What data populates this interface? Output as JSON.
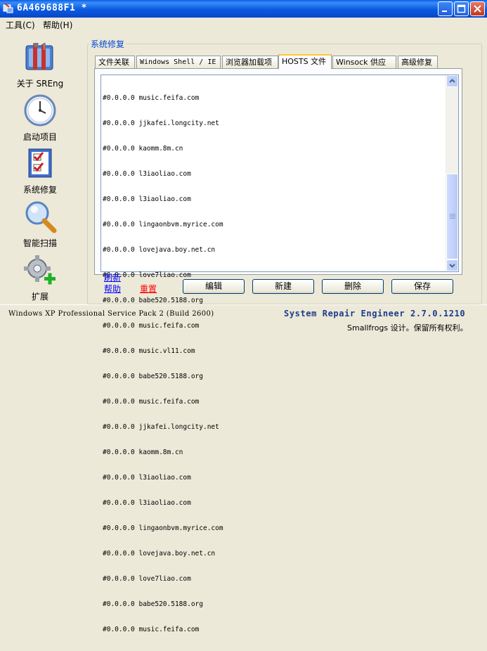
{
  "window": {
    "title": "6A469688F1 *"
  },
  "menu": {
    "tools": "工具(C)",
    "help": "帮助(H)"
  },
  "sidebar": {
    "items": [
      {
        "label": "关于 SREng",
        "icon": "toolbox-icon"
      },
      {
        "label": "启动项目",
        "icon": "clock-icon"
      },
      {
        "label": "系统修复",
        "icon": "checklist-icon"
      },
      {
        "label": "智能扫描",
        "icon": "magnifier-icon"
      },
      {
        "label": "扩展",
        "icon": "gear-plus-icon"
      }
    ]
  },
  "panel": {
    "group_label": "系统修复"
  },
  "tabs": [
    {
      "label": "文件关联"
    },
    {
      "label": "Windows Shell / IE"
    },
    {
      "label": "浏览器加载项"
    },
    {
      "label": "HOSTS 文件"
    },
    {
      "label": "Winsock 供应者"
    },
    {
      "label": "高级修复"
    }
  ],
  "hosts": {
    "lines": [
      "#0.0.0.0 music.feifa.com",
      "#0.0.0.0 jjkafei.longcity.net",
      "#0.0.0.0 kaomm.8m.cn",
      "#0.0.0.0 l3iaoliao.com",
      "#0.0.0.0 l3iaoliao.com",
      "#0.0.0.0 lingaonbvm.myrice.com",
      "#0.0.0.0 lovejava.boy.net.cn",
      "#0.0.0.0 love7liao.com",
      "#0.0.0.0 babe520.5188.org",
      "#0.0.0.0 music.feifa.com",
      "#0.0.0.0 music.vl11.com",
      "#0.0.0.0 babe520.5188.org",
      "#0.0.0.0 music.feifa.com",
      "#0.0.0.0 jjkafei.longcity.net",
      "#0.0.0.0 kaomm.8m.cn",
      "#0.0.0.0 l3iaoliao.com",
      "#0.0.0.0 l3iaoliao.com",
      "#0.0.0.0 lingaonbvm.myrice.com",
      "#0.0.0.0 lovejava.boy.net.cn",
      "#0.0.0.0 love7liao.com",
      "#0.0.0.0 babe520.5188.org",
      "#0.0.0.0 music.feifa.com"
    ]
  },
  "links": {
    "refresh": "刷新",
    "help": "帮助",
    "reset": "重置"
  },
  "buttons": {
    "edit": "编辑",
    "new": "新建",
    "delete": "删除",
    "save": "保存"
  },
  "status": {
    "os": "Windows XP Professional Service Pack 2 (Build 2600)",
    "product": "System Repair Engineer 2.7.0.1210",
    "copyright": "Smallfrogs 设计。保留所有权利。"
  },
  "colors": {
    "titlebar": "#0a5ae0",
    "link": "#0000ff",
    "reset_link": "#ff0000",
    "tab_highlight": "#ffc83c"
  }
}
